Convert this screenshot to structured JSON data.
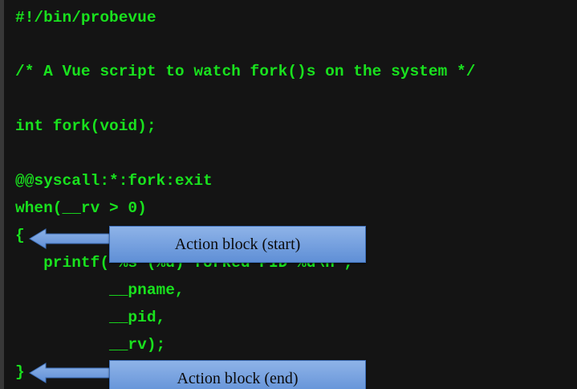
{
  "code": {
    "lines": [
      "#!/bin/probevue",
      "/* A Vue script to watch fork()s on the system */",
      "int fork(void);",
      "@@syscall:*:fork:exit",
      "when(__rv > 0)",
      "{",
      "   printf(\"%s (%d) forked PID %d\\n\",",
      "          __pname,",
      "          __pid,",
      "          __rv);",
      "}"
    ]
  },
  "callouts": {
    "start_label": "Action block (start)",
    "end_label": "Action block (end)"
  },
  "colors": {
    "code_text": "#19e11e",
    "background": "#141414",
    "callout_fill": "#7aa5e2"
  }
}
